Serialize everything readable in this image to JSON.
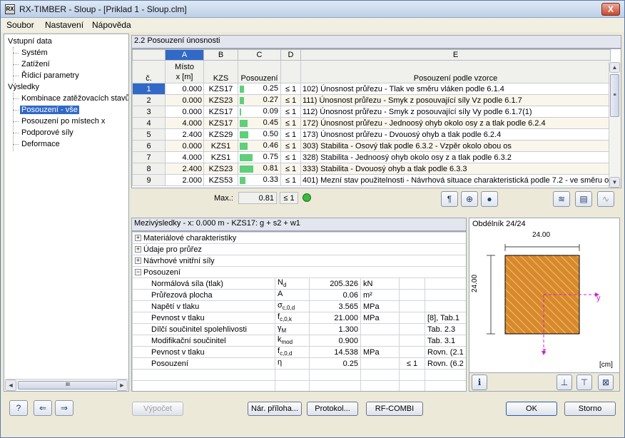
{
  "window": {
    "app_icon": "RX",
    "title": "RX-TIMBER - Sloup - [Priklad 1 - Sloup.clm]",
    "minimize": "_",
    "maximize": "□",
    "close": "X"
  },
  "menu": [
    "Soubor",
    "Nastavení",
    "Nápověda"
  ],
  "nav": {
    "items": [
      {
        "label": "Vstupní data",
        "level": 0
      },
      {
        "label": "Systém",
        "level": 1
      },
      {
        "label": "Zatížení",
        "level": 1
      },
      {
        "label": "Řídicí parametry",
        "level": 1
      },
      {
        "label": "Výsledky",
        "level": 0
      },
      {
        "label": "Kombinace zatěžovacích stavů",
        "level": 1
      },
      {
        "label": "Posouzení - vše",
        "level": 1,
        "selected": true
      },
      {
        "label": "Posouzení po místech x",
        "level": 1
      },
      {
        "label": "Podporové síly",
        "level": 1
      },
      {
        "label": "Deformace",
        "level": 1
      }
    ],
    "scroll_left": "◄",
    "scroll_right": "►",
    "scroll_grip": "III"
  },
  "results": {
    "title": "2.2 Posouzení únosnosti",
    "col_letters": [
      "A",
      "B",
      "C",
      "D",
      "E"
    ],
    "col_headers": {
      "num": "č.",
      "a_top": "Místo",
      "a": "x [m]",
      "b": "KZS",
      "c": "Posouzení",
      "d": "",
      "e": "Posouzení podle vzorce"
    },
    "rows": [
      {
        "no": "1",
        "x": "0.000",
        "kzs": "KZS17",
        "val": "0.25",
        "ratio": 0.25,
        "le": "≤ 1",
        "desc": "102) Únosnost průřezu - Tlak ve směru vláken podle 6.1.4"
      },
      {
        "no": "2",
        "x": "0.000",
        "kzs": "KZS23",
        "val": "0.27",
        "ratio": 0.27,
        "le": "≤ 1",
        "desc": "111) Únosnost průřezu - Smyk z posouvající síly Vz podle 6.1.7"
      },
      {
        "no": "3",
        "x": "0.000",
        "kzs": "KZS17",
        "val": "0.09",
        "ratio": 0.09,
        "le": "≤ 1",
        "desc": "112) Únosnost průřezu - Smyk z posouvající síly Vy podle 6.1.7(1)"
      },
      {
        "no": "4",
        "x": "4.000",
        "kzs": "KZS17",
        "val": "0.45",
        "ratio": 0.45,
        "le": "≤ 1",
        "desc": "172) Únosnost průřezu - Jednoosý ohyb okolo osy z a tlak podle 6.2.4"
      },
      {
        "no": "5",
        "x": "2.400",
        "kzs": "KZS29",
        "val": "0.50",
        "ratio": 0.5,
        "le": "≤ 1",
        "desc": "173) Únosnost průřezu - Dvouosý ohyb a tlak podle 6.2.4"
      },
      {
        "no": "6",
        "x": "0.000",
        "kzs": "KZS1",
        "val": "0.46",
        "ratio": 0.46,
        "le": "≤ 1",
        "desc": "303) Stabilita - Osový tlak podle 6.3.2 - Vzpěr okolo obou os"
      },
      {
        "no": "7",
        "x": "4.000",
        "kzs": "KZS1",
        "val": "0.75",
        "ratio": 0.75,
        "le": "≤ 1",
        "desc": "328) Stabilita - Jednoosý ohyb okolo osy z a tlak podle 6.3.2"
      },
      {
        "no": "8",
        "x": "2.400",
        "kzs": "KZS23",
        "val": "0.81",
        "ratio": 0.81,
        "le": "≤ 1",
        "desc": "333) Stabilita - Dvouosý ohyb a tlak podle 6.3.3"
      },
      {
        "no": "9",
        "x": "2.000",
        "kzs": "KZS53",
        "val": "0.33",
        "ratio": 0.33,
        "le": "≤ 1",
        "desc": "401) Mezní stav použitelnosti - Návrhová situace charakteristická podle 7.2 - ve směru o"
      }
    ],
    "max_label": "Max.:",
    "max_value": "0.81",
    "max_le": "≤ 1",
    "scroll_up": "▲",
    "scroll_down": "▼",
    "scroll_grip": "≡"
  },
  "intermediate": {
    "title": "Mezivýsledky  -  x: 0.000 m  -  KZS17: g + s2 + w1",
    "groups": [
      {
        "label": "Materiálové charakteristiky",
        "expanded": false
      },
      {
        "label": "Údaje pro průřez",
        "expanded": false
      },
      {
        "label": "Návrhové vnitřní síly",
        "expanded": false
      },
      {
        "label": "Posouzení",
        "expanded": true
      }
    ],
    "rows": [
      {
        "name": "Normálová síla (tlak)",
        "sym": "N",
        "sub": "d",
        "val": "205.326",
        "unit": "kN",
        "le": "",
        "ref": ""
      },
      {
        "name": "Průřezová plocha",
        "sym": "A",
        "sub": "",
        "val": "0.06",
        "unit": "m²",
        "le": "",
        "ref": ""
      },
      {
        "name": "Napětí v tlaku",
        "sym": "σ",
        "sub": "c,0,d",
        "val": "3.565",
        "unit": "MPa",
        "le": "",
        "ref": ""
      },
      {
        "name": "Pevnost v tlaku",
        "sym": "f",
        "sub": "c,0,k",
        "val": "21.000",
        "unit": "MPa",
        "le": "",
        "ref": "[8], Tab.1"
      },
      {
        "name": "Dílčí součinitel spolehlivosti",
        "sym": "γ",
        "sub": "M",
        "val": "1.300",
        "unit": "",
        "le": "",
        "ref": "Tab. 2.3"
      },
      {
        "name": "Modifikační součinitel",
        "sym": "k",
        "sub": "mod",
        "val": "0.900",
        "unit": "",
        "le": "",
        "ref": "Tab. 3.1"
      },
      {
        "name": "Pevnost v tlaku",
        "sym": "f",
        "sub": "c,0,d",
        "val": "14.538",
        "unit": "MPa",
        "le": "",
        "ref": "Rovn. (2.1"
      },
      {
        "name": "Posouzení",
        "sym": "η",
        "sub": "",
        "val": "0.25",
        "unit": "",
        "le": "≤ 1",
        "ref": "Rovn. (6.2"
      }
    ]
  },
  "section": {
    "title": "Obdélník 24/24",
    "width_label": "24.00",
    "height_label": "24.00",
    "axis_y": "y",
    "axis_z": "z",
    "unit": "[cm]"
  },
  "buttons": {
    "vypocet": "Výpočet",
    "nar_priloha": "Nár. příloha...",
    "protokol": "Protokol...",
    "rf_combi": "RF-COMBI",
    "ok": "OK",
    "storno": "Storno"
  },
  "icons": {
    "help": "?",
    "import": "⇐",
    "export": "⇒",
    "info": "i",
    "tool1": "¶",
    "tool2": "⊕",
    "tool3": "●",
    "tool4": "≋",
    "tool5": "▤",
    "tool6": "∿",
    "sec1": "⊥",
    "sec2": "⊤",
    "sec3": "⊠"
  },
  "colors": {
    "selection": "#3169c6",
    "bar_green": "#5ecf7a",
    "timber": "#d8892a",
    "axis": "#d020d0"
  }
}
